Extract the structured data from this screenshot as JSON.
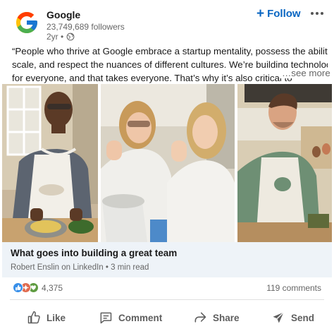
{
  "post": {
    "org_name": "Google",
    "followers": "23,749,689 followers",
    "age": "2yr •",
    "visibility_icon": "globe-icon",
    "follow_label": "Follow",
    "follow_color": "#0a66c2",
    "text_lines": [
      "“People who thrive at Google embrace a startup mentality, possess the ability to",
      "scale, and respect the nuances of different cultures. We’re building technology",
      "for everyone, and that takes everyone. That’s why it’s also critical to"
    ],
    "see_more": "…see more"
  },
  "photos": [
    {
      "icon": "photo-man-cooking"
    },
    {
      "icon": "photo-women-tasting"
    },
    {
      "icon": "photo-man-smiling"
    }
  ],
  "link": {
    "title": "What goes into building a great team",
    "source": "Robert Enslin on LinkedIn • 3 min read"
  },
  "social": {
    "reaction_icons": [
      "like-icon",
      "celebrate-icon",
      "support-icon"
    ],
    "reaction_count": "4,375",
    "comments": "119 comments"
  },
  "actions": [
    {
      "label": "Like",
      "icon": "like-thumb-icon"
    },
    {
      "label": "Comment",
      "icon": "comment-icon"
    },
    {
      "label": "Share",
      "icon": "share-icon"
    },
    {
      "label": "Send",
      "icon": "send-icon"
    }
  ]
}
